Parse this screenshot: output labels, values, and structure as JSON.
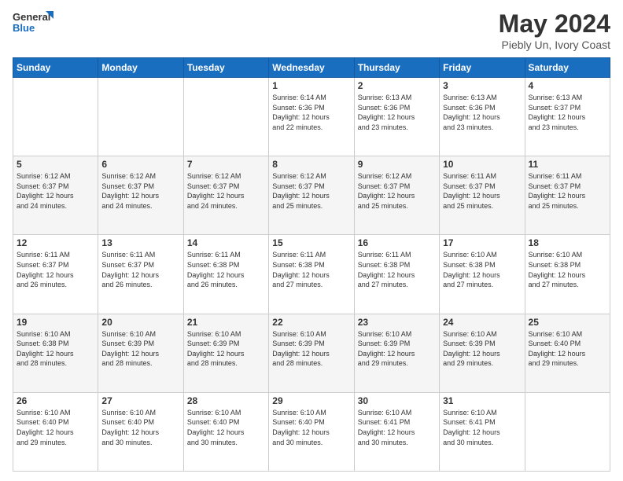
{
  "header": {
    "logo_line1": "General",
    "logo_line2": "Blue",
    "title": "May 2024",
    "subtitle": "Piebly Un, Ivory Coast"
  },
  "days_of_week": [
    "Sunday",
    "Monday",
    "Tuesday",
    "Wednesday",
    "Thursday",
    "Friday",
    "Saturday"
  ],
  "weeks": [
    [
      {
        "day": "",
        "info": ""
      },
      {
        "day": "",
        "info": ""
      },
      {
        "day": "",
        "info": ""
      },
      {
        "day": "1",
        "info": "Sunrise: 6:14 AM\nSunset: 6:36 PM\nDaylight: 12 hours\nand 22 minutes."
      },
      {
        "day": "2",
        "info": "Sunrise: 6:13 AM\nSunset: 6:36 PM\nDaylight: 12 hours\nand 23 minutes."
      },
      {
        "day": "3",
        "info": "Sunrise: 6:13 AM\nSunset: 6:36 PM\nDaylight: 12 hours\nand 23 minutes."
      },
      {
        "day": "4",
        "info": "Sunrise: 6:13 AM\nSunset: 6:37 PM\nDaylight: 12 hours\nand 23 minutes."
      }
    ],
    [
      {
        "day": "5",
        "info": "Sunrise: 6:12 AM\nSunset: 6:37 PM\nDaylight: 12 hours\nand 24 minutes."
      },
      {
        "day": "6",
        "info": "Sunrise: 6:12 AM\nSunset: 6:37 PM\nDaylight: 12 hours\nand 24 minutes."
      },
      {
        "day": "7",
        "info": "Sunrise: 6:12 AM\nSunset: 6:37 PM\nDaylight: 12 hours\nand 24 minutes."
      },
      {
        "day": "8",
        "info": "Sunrise: 6:12 AM\nSunset: 6:37 PM\nDaylight: 12 hours\nand 25 minutes."
      },
      {
        "day": "9",
        "info": "Sunrise: 6:12 AM\nSunset: 6:37 PM\nDaylight: 12 hours\nand 25 minutes."
      },
      {
        "day": "10",
        "info": "Sunrise: 6:11 AM\nSunset: 6:37 PM\nDaylight: 12 hours\nand 25 minutes."
      },
      {
        "day": "11",
        "info": "Sunrise: 6:11 AM\nSunset: 6:37 PM\nDaylight: 12 hours\nand 25 minutes."
      }
    ],
    [
      {
        "day": "12",
        "info": "Sunrise: 6:11 AM\nSunset: 6:37 PM\nDaylight: 12 hours\nand 26 minutes."
      },
      {
        "day": "13",
        "info": "Sunrise: 6:11 AM\nSunset: 6:37 PM\nDaylight: 12 hours\nand 26 minutes."
      },
      {
        "day": "14",
        "info": "Sunrise: 6:11 AM\nSunset: 6:38 PM\nDaylight: 12 hours\nand 26 minutes."
      },
      {
        "day": "15",
        "info": "Sunrise: 6:11 AM\nSunset: 6:38 PM\nDaylight: 12 hours\nand 27 minutes."
      },
      {
        "day": "16",
        "info": "Sunrise: 6:11 AM\nSunset: 6:38 PM\nDaylight: 12 hours\nand 27 minutes."
      },
      {
        "day": "17",
        "info": "Sunrise: 6:10 AM\nSunset: 6:38 PM\nDaylight: 12 hours\nand 27 minutes."
      },
      {
        "day": "18",
        "info": "Sunrise: 6:10 AM\nSunset: 6:38 PM\nDaylight: 12 hours\nand 27 minutes."
      }
    ],
    [
      {
        "day": "19",
        "info": "Sunrise: 6:10 AM\nSunset: 6:38 PM\nDaylight: 12 hours\nand 28 minutes."
      },
      {
        "day": "20",
        "info": "Sunrise: 6:10 AM\nSunset: 6:39 PM\nDaylight: 12 hours\nand 28 minutes."
      },
      {
        "day": "21",
        "info": "Sunrise: 6:10 AM\nSunset: 6:39 PM\nDaylight: 12 hours\nand 28 minutes."
      },
      {
        "day": "22",
        "info": "Sunrise: 6:10 AM\nSunset: 6:39 PM\nDaylight: 12 hours\nand 28 minutes."
      },
      {
        "day": "23",
        "info": "Sunrise: 6:10 AM\nSunset: 6:39 PM\nDaylight: 12 hours\nand 29 minutes."
      },
      {
        "day": "24",
        "info": "Sunrise: 6:10 AM\nSunset: 6:39 PM\nDaylight: 12 hours\nand 29 minutes."
      },
      {
        "day": "25",
        "info": "Sunrise: 6:10 AM\nSunset: 6:40 PM\nDaylight: 12 hours\nand 29 minutes."
      }
    ],
    [
      {
        "day": "26",
        "info": "Sunrise: 6:10 AM\nSunset: 6:40 PM\nDaylight: 12 hours\nand 29 minutes."
      },
      {
        "day": "27",
        "info": "Sunrise: 6:10 AM\nSunset: 6:40 PM\nDaylight: 12 hours\nand 30 minutes."
      },
      {
        "day": "28",
        "info": "Sunrise: 6:10 AM\nSunset: 6:40 PM\nDaylight: 12 hours\nand 30 minutes."
      },
      {
        "day": "29",
        "info": "Sunrise: 6:10 AM\nSunset: 6:40 PM\nDaylight: 12 hours\nand 30 minutes."
      },
      {
        "day": "30",
        "info": "Sunrise: 6:10 AM\nSunset: 6:41 PM\nDaylight: 12 hours\nand 30 minutes."
      },
      {
        "day": "31",
        "info": "Sunrise: 6:10 AM\nSunset: 6:41 PM\nDaylight: 12 hours\nand 30 minutes."
      },
      {
        "day": "",
        "info": ""
      }
    ]
  ]
}
